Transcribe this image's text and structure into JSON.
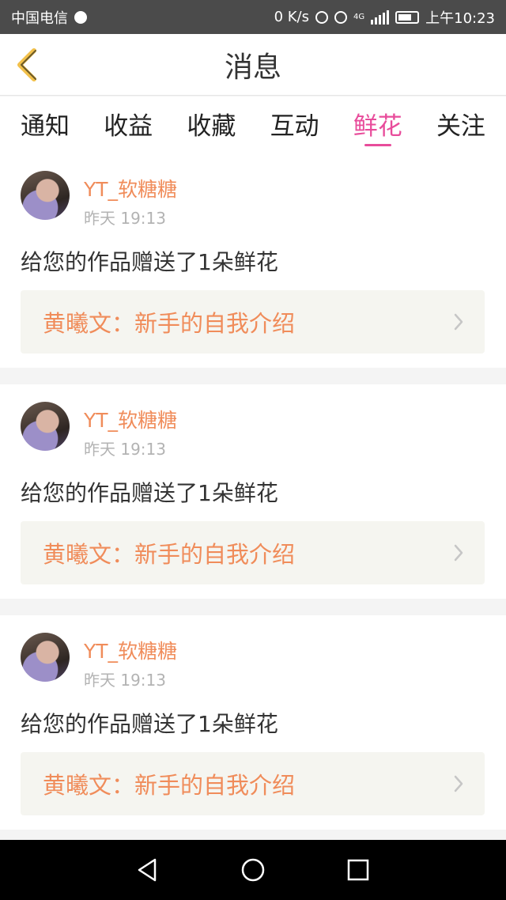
{
  "status": {
    "carrier": "中国电信",
    "speed": "0 K/s",
    "network": "4G",
    "time": "上午10:23"
  },
  "header": {
    "title": "消息",
    "back_icon": "chevron-left-icon"
  },
  "tabs": [
    {
      "label": "通知",
      "active": false
    },
    {
      "label": "收益",
      "active": false
    },
    {
      "label": "收藏",
      "active": false
    },
    {
      "label": "互动",
      "active": false
    },
    {
      "label": "鲜花",
      "active": true
    },
    {
      "label": "关注",
      "active": false
    }
  ],
  "messages": [
    {
      "username": "YT_软糖糖",
      "time": "昨天 19:13",
      "text": "给您的作品赠送了1朵鲜花",
      "work": "黄曦文：新手的自我介绍"
    },
    {
      "username": "YT_软糖糖",
      "time": "昨天 19:13",
      "text": "给您的作品赠送了1朵鲜花",
      "work": "黄曦文：新手的自我介绍"
    },
    {
      "username": "YT_软糖糖",
      "time": "昨天 19:13",
      "text": "给您的作品赠送了1朵鲜花",
      "work": "黄曦文：新手的自我介绍"
    }
  ],
  "colors": {
    "accent": "#e84c9b",
    "username": "#f08c5a",
    "back": "#f2c04a"
  }
}
